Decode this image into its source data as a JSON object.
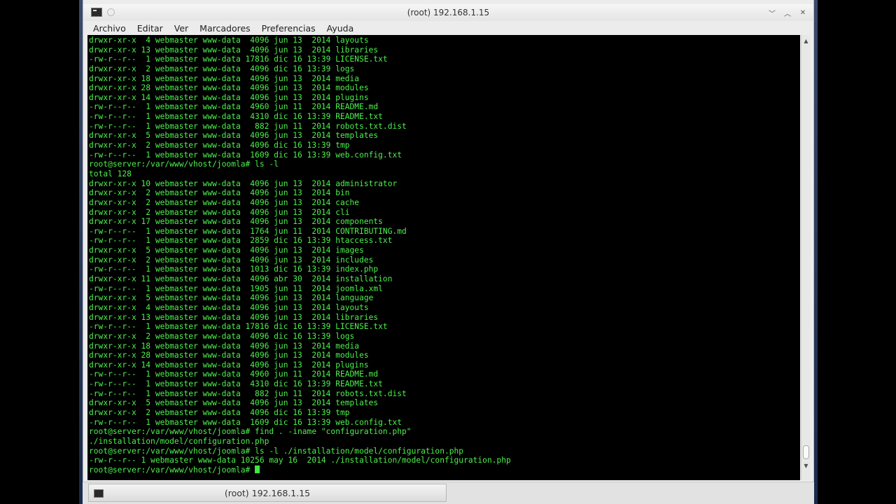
{
  "window": {
    "title": "(root) 192.168.1.15",
    "buttons": {
      "minimize": "﹀",
      "maximize": "︿",
      "close": "✕"
    }
  },
  "menu": [
    "Archivo",
    "Editar",
    "Ver",
    "Marcadores",
    "Preferencias",
    "Ayuda"
  ],
  "terminal": {
    "lines": [
      "drwxr-xr-x  4 webmaster www-data  4096 jun 13  2014 layouts",
      "drwxr-xr-x 13 webmaster www-data  4096 jun 13  2014 libraries",
      "-rw-r--r--  1 webmaster www-data 17816 dic 16 13:39 LICENSE.txt",
      "drwxr-xr-x  2 webmaster www-data  4096 dic 16 13:39 logs",
      "drwxr-xr-x 18 webmaster www-data  4096 jun 13  2014 media",
      "drwxr-xr-x 28 webmaster www-data  4096 jun 13  2014 modules",
      "drwxr-xr-x 14 webmaster www-data  4096 jun 13  2014 plugins",
      "-rw-r--r--  1 webmaster www-data  4960 jun 11  2014 README.md",
      "-rw-r--r--  1 webmaster www-data  4310 dic 16 13:39 README.txt",
      "-rw-r--r--  1 webmaster www-data   882 jun 11  2014 robots.txt.dist",
      "drwxr-xr-x  5 webmaster www-data  4096 jun 13  2014 templates",
      "drwxr-xr-x  2 webmaster www-data  4096 dic 16 13:39 tmp",
      "-rw-r--r--  1 webmaster www-data  1609 dic 16 13:39 web.config.txt",
      "root@server:/var/www/vhost/joomla# ls -l",
      "total 128",
      "drwxr-xr-x 10 webmaster www-data  4096 jun 13  2014 administrator",
      "drwxr-xr-x  2 webmaster www-data  4096 jun 13  2014 bin",
      "drwxr-xr-x  2 webmaster www-data  4096 jun 13  2014 cache",
      "drwxr-xr-x  2 webmaster www-data  4096 jun 13  2014 cli",
      "drwxr-xr-x 17 webmaster www-data  4096 jun 13  2014 components",
      "-rw-r--r--  1 webmaster www-data  1764 jun 11  2014 CONTRIBUTING.md",
      "-rw-r--r--  1 webmaster www-data  2859 dic 16 13:39 htaccess.txt",
      "drwxr-xr-x  5 webmaster www-data  4096 jun 13  2014 images",
      "drwxr-xr-x  2 webmaster www-data  4096 jun 13  2014 includes",
      "-rw-r--r--  1 webmaster www-data  1013 dic 16 13:39 index.php",
      "drwxr-xr-x 11 webmaster www-data  4096 abr 30  2014 installation",
      "-rw-r--r--  1 webmaster www-data  1905 jun 11  2014 joomla.xml",
      "drwxr-xr-x  5 webmaster www-data  4096 jun 13  2014 language",
      "drwxr-xr-x  4 webmaster www-data  4096 jun 13  2014 layouts",
      "drwxr-xr-x 13 webmaster www-data  4096 jun 13  2014 libraries",
      "-rw-r--r--  1 webmaster www-data 17816 dic 16 13:39 LICENSE.txt",
      "drwxr-xr-x  2 webmaster www-data  4096 dic 16 13:39 logs",
      "drwxr-xr-x 18 webmaster www-data  4096 jun 13  2014 media",
      "drwxr-xr-x 28 webmaster www-data  4096 jun 13  2014 modules",
      "drwxr-xr-x 14 webmaster www-data  4096 jun 13  2014 plugins",
      "-rw-r--r--  1 webmaster www-data  4960 jun 11  2014 README.md",
      "-rw-r--r--  1 webmaster www-data  4310 dic 16 13:39 README.txt",
      "-rw-r--r--  1 webmaster www-data   882 jun 11  2014 robots.txt.dist",
      "drwxr-xr-x  5 webmaster www-data  4096 jun 13  2014 templates",
      "drwxr-xr-x  2 webmaster www-data  4096 dic 16 13:39 tmp",
      "-rw-r--r--  1 webmaster www-data  1609 dic 16 13:39 web.config.txt",
      "root@server:/var/www/vhost/joomla# find . -iname \"configuration.php\"",
      "./installation/model/configuration.php",
      "root@server:/var/www/vhost/joomla# ls -l ./installation/model/configuration.php",
      "-rw-r--r-- 1 webmaster www-data 10256 may 16  2014 ./installation/model/configuration.php"
    ],
    "prompt": "root@server:/var/www/vhost/joomla# "
  },
  "taskbar": {
    "item_label": "(root) 192.168.1.15"
  }
}
